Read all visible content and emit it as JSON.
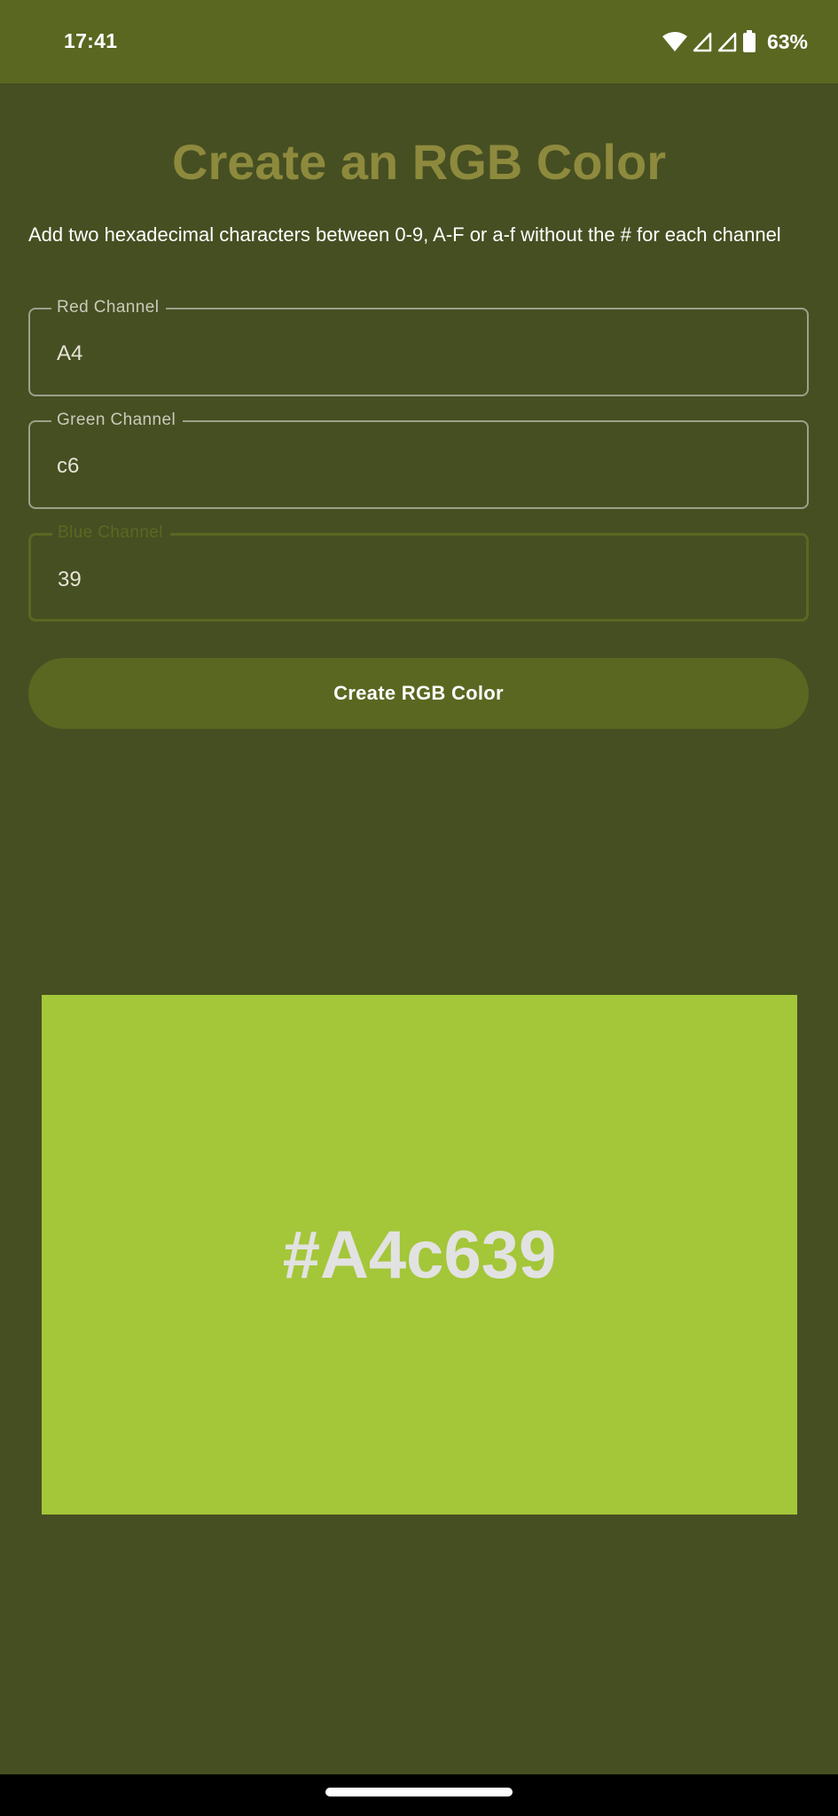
{
  "status_bar": {
    "time": "17:41",
    "battery_percent": "63%",
    "icons": [
      "wifi-icon",
      "cell-signal-icon",
      "cell-signal-icon",
      "battery-icon"
    ]
  },
  "page": {
    "title": "Create an RGB Color",
    "instructions": "Add two hexadecimal characters between 0-9, A-F or a-f without the # for each channel"
  },
  "fields": {
    "red": {
      "label": "Red Channel",
      "value": "A4"
    },
    "green": {
      "label": "Green Channel",
      "value": "c6"
    },
    "blue": {
      "label": "Blue Channel",
      "value": "39"
    }
  },
  "button": {
    "label": "Create RGB Color"
  },
  "result": {
    "hex_label": "#A4c639",
    "swatch_color": "#a4c639"
  },
  "colors": {
    "background": "#464f22",
    "accent": "#5a6721",
    "title": "#8e8a3d"
  }
}
